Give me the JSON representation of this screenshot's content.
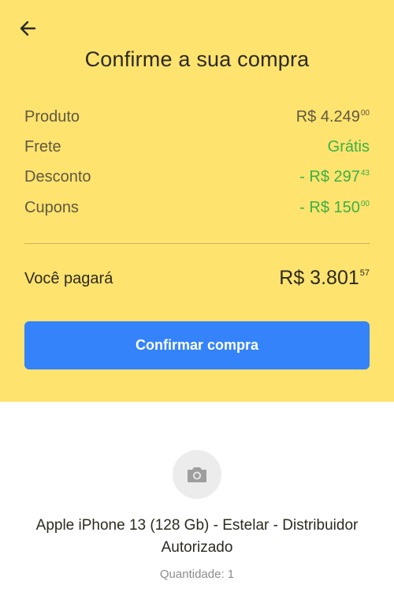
{
  "header": {
    "title": "Confirme a sua compra"
  },
  "summary": {
    "rows": [
      {
        "label": "Produto",
        "value": "R$ 4.249",
        "cents": "00"
      },
      {
        "label": "Frete",
        "value": "Grátis",
        "cents": ""
      },
      {
        "label": "Desconto",
        "value": "- R$ 297",
        "cents": "43"
      },
      {
        "label": "Cupons",
        "value": "- R$ 150",
        "cents": "00"
      }
    ],
    "total_label": "Você pagará",
    "total_value": "R$ 3.801",
    "total_cents": "57"
  },
  "actions": {
    "confirm_label": "Confirmar compra"
  },
  "product": {
    "name": "Apple iPhone 13 (128 Gb) - Estelar - Distribuidor Autorizado",
    "quantity": "Quantidade: 1"
  },
  "colors": {
    "header_bg": "#fee36f",
    "accent_blue": "#3483fa",
    "discount_green": "#3db044"
  }
}
